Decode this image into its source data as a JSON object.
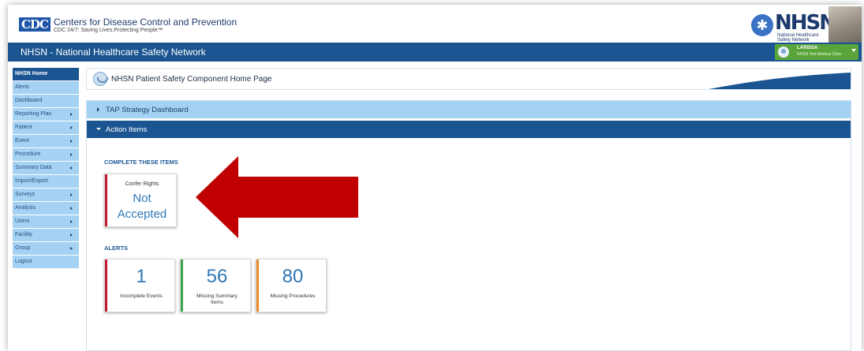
{
  "header": {
    "logo_text": "CDC",
    "org_name": "Centers for Disease Control and Prevention",
    "tagline": "CDC 24/7: Saving Lives.Protecting People™",
    "nhsn_logo": "NHSN",
    "nhsn_logo_sub": "National Healthcare Safety Network"
  },
  "title_bar": {
    "title": "NHSN - National Healthcare Safety Network",
    "user_name": "LARISSA",
    "user_facility": "NHSN Test Medical Clinic"
  },
  "sidebar": {
    "items": [
      {
        "label": "NHSN Home",
        "active": true,
        "has_submenu": false
      },
      {
        "label": "Alerts",
        "has_submenu": false
      },
      {
        "label": "Dashboard",
        "has_submenu": false
      },
      {
        "label": "Reporting Plan",
        "has_submenu": true
      },
      {
        "label": "Patient",
        "has_submenu": true
      },
      {
        "label": "Event",
        "has_submenu": true
      },
      {
        "label": "Procedure",
        "has_submenu": true
      },
      {
        "label": "Summary Data",
        "has_submenu": true
      },
      {
        "label": "Import/Export",
        "has_submenu": false
      },
      {
        "label": "Surveys",
        "has_submenu": true
      },
      {
        "label": "Analysis",
        "has_submenu": true
      },
      {
        "label": "Users",
        "has_submenu": true
      },
      {
        "label": "Facility",
        "has_submenu": true
      },
      {
        "label": "Group",
        "has_submenu": true
      },
      {
        "label": "Logout",
        "has_submenu": false
      }
    ]
  },
  "page": {
    "title": "NHSN Patient Safety Component Home Page"
  },
  "panels": {
    "tap_label": "TAP Strategy Dashboard",
    "action_label": "Action Items"
  },
  "complete_items": {
    "section_title": "COMPLETE THESE ITEMS",
    "tile": {
      "caption": "Confer Rights",
      "status_line1": "Not",
      "status_line2": "Accepted",
      "stripe_color": "#c0182c"
    }
  },
  "alerts": {
    "section_title": "ALERTS",
    "tiles": [
      {
        "value": "1",
        "label": "Incomplete Events",
        "stripe_color": "#c0182c"
      },
      {
        "value": "56",
        "label": "Missing Summary Items",
        "stripe_color": "#3ea34a"
      },
      {
        "value": "80",
        "label": "Missing Procedures",
        "stripe_color": "#e88a2a"
      }
    ]
  },
  "colors": {
    "primary_blue": "#1b5591",
    "light_blue": "#a5d2f2",
    "arrow_red": "#c00000",
    "user_green": "#5aa53a"
  }
}
